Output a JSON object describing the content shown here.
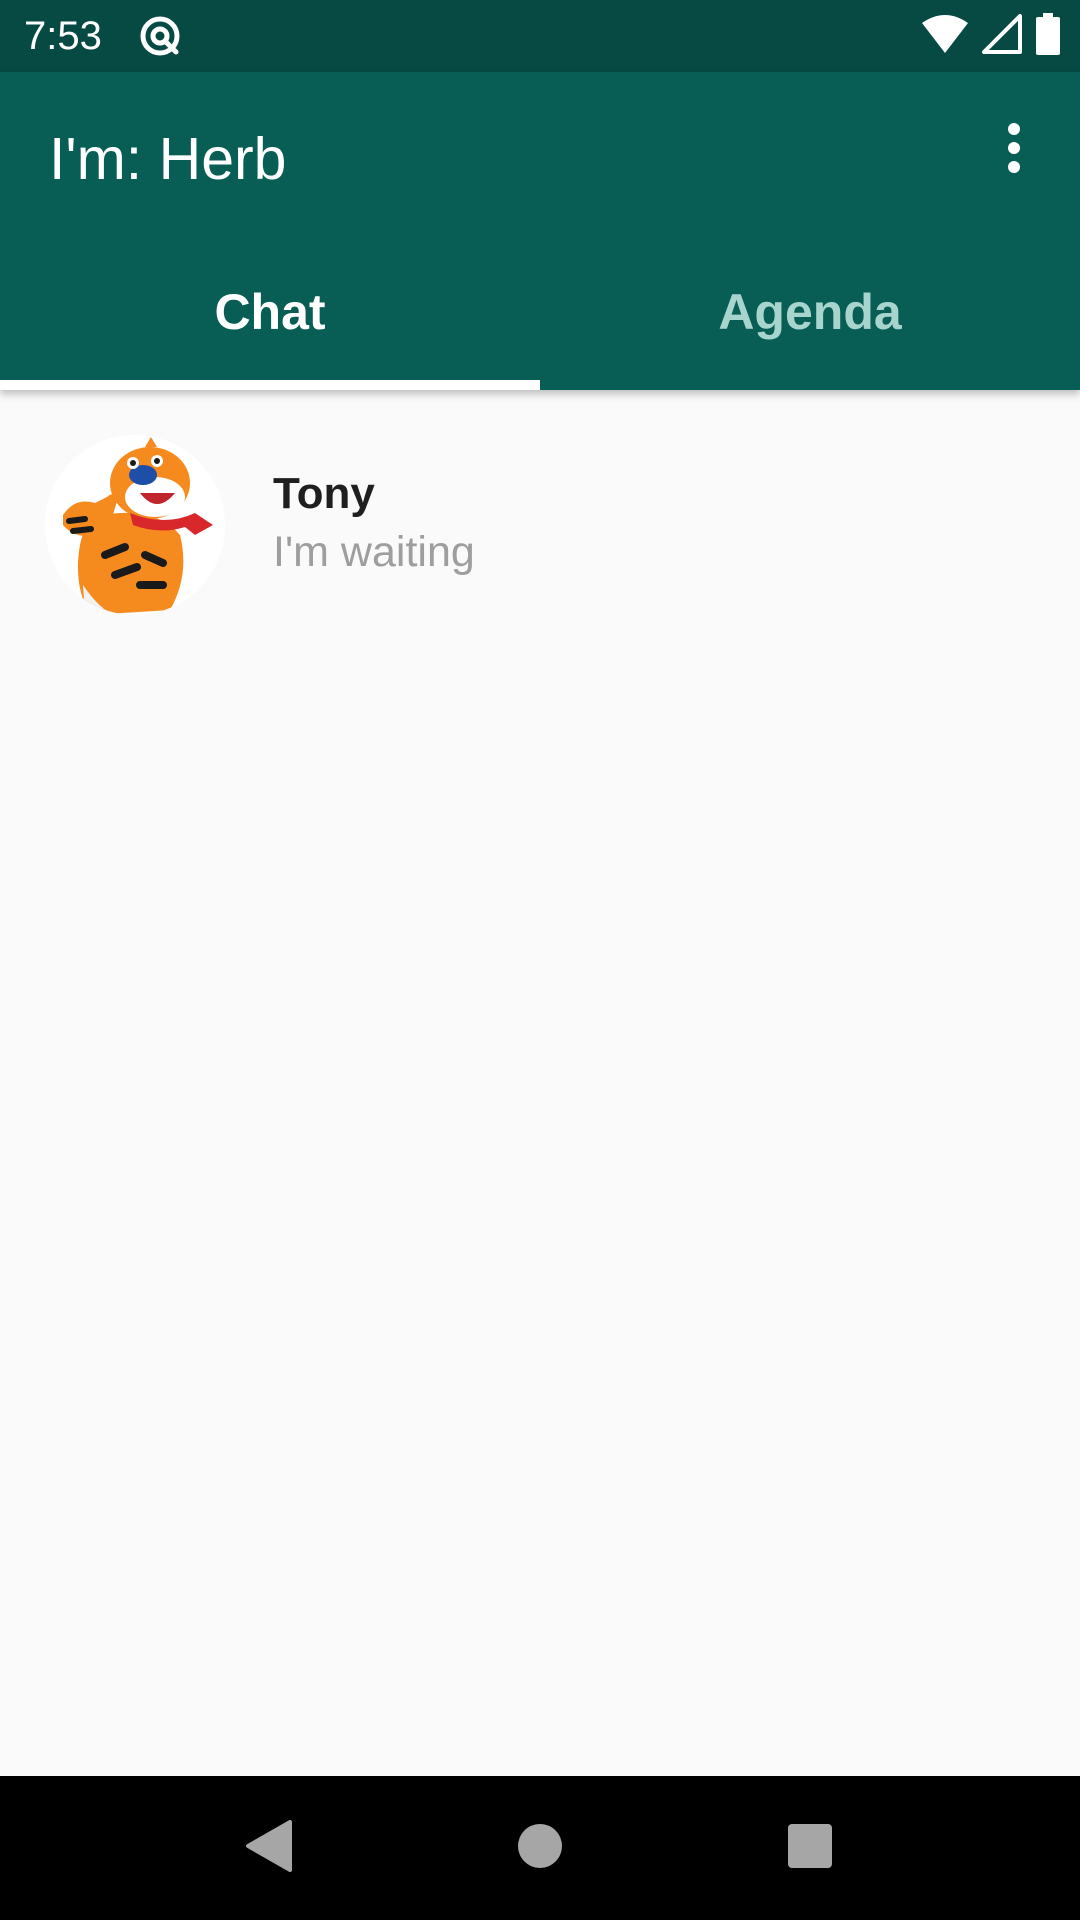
{
  "status_bar": {
    "time": "7:53",
    "icons": [
      "app-notification-icon",
      "wifi-icon",
      "cellular-signal-icon",
      "battery-icon"
    ]
  },
  "app_bar": {
    "title": "I'm: Herb",
    "overflow_icon": "more-vert-icon"
  },
  "tabs": [
    {
      "label": "Chat",
      "selected": true
    },
    {
      "label": "Agenda",
      "selected": false
    }
  ],
  "chats": [
    {
      "name": "Tony",
      "last_message": "I'm waiting",
      "avatar": "tiger-mascot-avatar"
    }
  ],
  "nav_bar": {
    "icons": [
      "back-icon",
      "home-icon",
      "recents-icon"
    ]
  },
  "colors": {
    "status_bar": "#074a43",
    "app_bar": "#085e55",
    "tab_selected_text": "#ffffff",
    "tab_unselected_text": "#a8d4ce",
    "background": "#fafafa",
    "name_text": "#1f1f1f",
    "message_text": "#9e9e9e"
  }
}
